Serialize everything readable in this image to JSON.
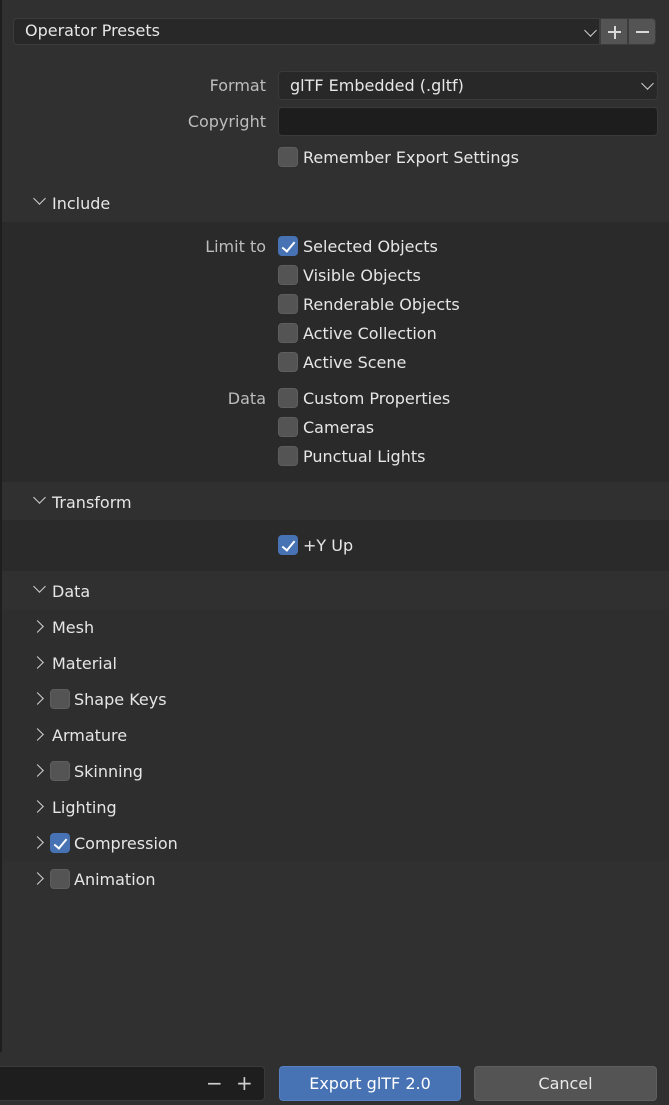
{
  "presets": {
    "label": "Operator Presets"
  },
  "settings": {
    "format_label": "Format",
    "format_value": "glTF Embedded (.gltf)",
    "copyright_label": "Copyright",
    "copyright_value": "",
    "remember_label": "Remember Export Settings",
    "remember_checked": false
  },
  "include": {
    "title": "Include",
    "limit_label": "Limit to",
    "limit_items": [
      {
        "label": "Selected Objects",
        "checked": true
      },
      {
        "label": "Visible Objects",
        "checked": false
      },
      {
        "label": "Renderable Objects",
        "checked": false
      },
      {
        "label": "Active Collection",
        "checked": false
      },
      {
        "label": "Active Scene",
        "checked": false
      }
    ],
    "data_label": "Data",
    "data_items": [
      {
        "label": "Custom Properties",
        "checked": false
      },
      {
        "label": "Cameras",
        "checked": false
      },
      {
        "label": "Punctual Lights",
        "checked": false
      }
    ]
  },
  "transform": {
    "title": "Transform",
    "yup_label": "+Y Up",
    "yup_checked": true
  },
  "data_panel": {
    "title": "Data",
    "subpanels": [
      {
        "label": "Mesh",
        "has_checkbox": false,
        "checked": false
      },
      {
        "label": "Material",
        "has_checkbox": false,
        "checked": false
      },
      {
        "label": "Shape Keys",
        "has_checkbox": true,
        "checked": false
      },
      {
        "label": "Armature",
        "has_checkbox": false,
        "checked": false
      },
      {
        "label": "Skinning",
        "has_checkbox": true,
        "checked": false
      },
      {
        "label": "Lighting",
        "has_checkbox": false,
        "checked": false
      },
      {
        "label": "Compression",
        "has_checkbox": true,
        "checked": true
      },
      {
        "label": "Animation",
        "has_checkbox": true,
        "checked": false
      }
    ]
  },
  "footer": {
    "filename_value": "",
    "decrement_symbol": "−",
    "increment_symbol": "+",
    "export_label": "Export glTF 2.0",
    "cancel_label": "Cancel"
  },
  "colors": {
    "accent": "#4772b3",
    "background": "#303030",
    "panel": "#2a2a2a"
  }
}
